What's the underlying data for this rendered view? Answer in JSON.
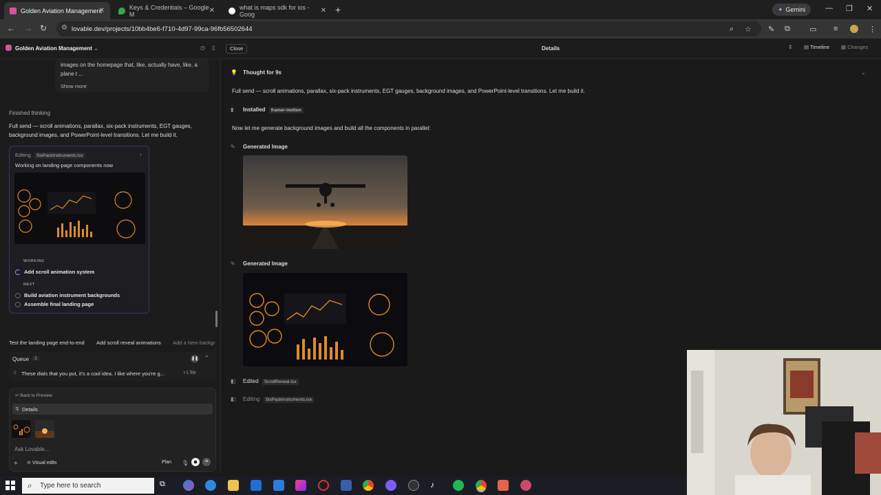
{
  "browser": {
    "tabs": [
      {
        "title": "Golden Aviation Management",
        "active": true
      },
      {
        "title": "Keys & Credentials – Google M",
        "active": false
      },
      {
        "title": "what is maps sdk for ios - Goog",
        "active": false
      }
    ],
    "gemini_label": "Gemini",
    "url": "lovable.dev/projects/10bb4be6-f710-4d97-99ca-96fb56502644"
  },
  "header": {
    "project_name": "Golden Aviation Management",
    "close_label": "Close",
    "details_title": "Details",
    "timeline_label": "Timeline",
    "changes_label": "Changes"
  },
  "chat": {
    "prev_message": "images on the homepage that, like, actually have, like, a plane t ...",
    "show_more": "Show more",
    "finished_thinking": "Finished thinking",
    "response": "Full send — scroll animations, parallax, six-pack instruments, EGT gauges, background images, and PowerPoint-level transitions. Let me build it.",
    "edit_card": {
      "status": "Editing",
      "file": "SixPackInstruments.tsx",
      "subtitle": "Working on landing-page components now",
      "working_label": "WORKING",
      "working_task": "Add scroll animation system",
      "next_label": "NEXT",
      "next_tasks": [
        "Build aviation instrument backgrounds",
        "Assemble final landing page"
      ]
    },
    "suggestions": [
      "Test the landing page end-to-end",
      "Add scroll reveal animations",
      "Add a hero background"
    ],
    "queue": {
      "title": "Queue",
      "count": "1",
      "item": "These dials that you put, it's a cool idea. I like where you're g...",
      "files": "+1 file"
    },
    "input": {
      "back_to_preview": "Back to Preview",
      "details": "Details",
      "placeholder": "Ask Lovable...",
      "visual_edits": "Visual edits",
      "plan": "Plan"
    }
  },
  "details": {
    "thought": "Thought for 9s",
    "thought_text": "Full send — scroll animations, parallax, six-pack instruments, EGT gauges, background images, and PowerPoint-level transitions. Let me build it.",
    "installed_label": "Installed",
    "installed_pkg": "framer-motion",
    "generate_text": "Now let me generate background images and build all the components in parallel:",
    "generated_image_1": "Generated Image",
    "generated_image_2": "Generated Image",
    "edited_label": "Edited",
    "edited_file": "ScrollReveal.tsx",
    "editing_label": "Editing",
    "editing_file": "SixPackInstruments.tsx"
  },
  "taskbar": {
    "search_placeholder": "Type here to search"
  },
  "colors": {
    "accent_border": "#34386c",
    "brand_gradient_start": "#ff5a5f",
    "brand_gradient_end": "#b04ae0",
    "gauge_orange": "#e08a2a"
  }
}
